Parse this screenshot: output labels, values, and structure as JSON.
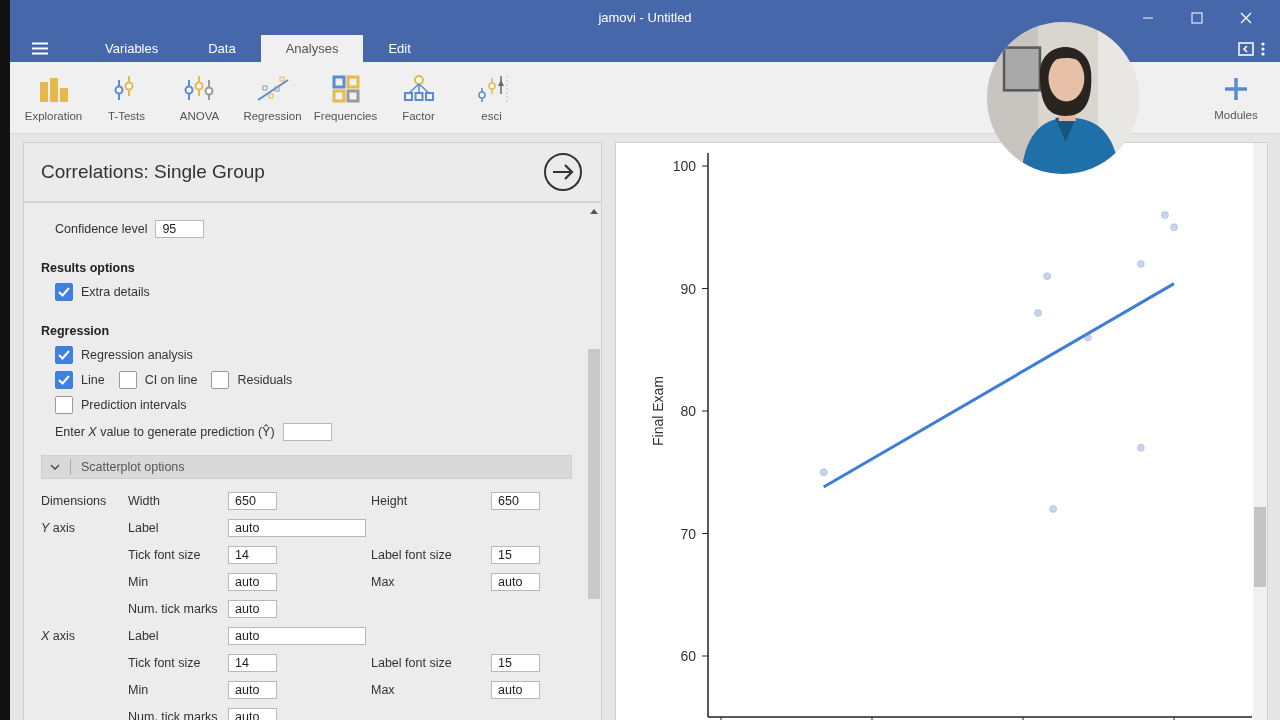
{
  "window": {
    "title": "jamovi - Untitled"
  },
  "menu_tabs": [
    {
      "label": "Variables",
      "selected": false
    },
    {
      "label": "Data",
      "selected": false
    },
    {
      "label": "Analyses",
      "selected": true
    },
    {
      "label": "Edit",
      "selected": false
    }
  ],
  "toolbar": [
    {
      "label": "Exploration",
      "kind": "exploration"
    },
    {
      "label": "T-Tests",
      "kind": "ttests"
    },
    {
      "label": "ANOVA",
      "kind": "anova"
    },
    {
      "label": "Regression",
      "kind": "regression"
    },
    {
      "label": "Frequencies",
      "kind": "frequencies"
    },
    {
      "label": "Factor",
      "kind": "factor"
    },
    {
      "label": "esci",
      "kind": "esci"
    }
  ],
  "modules": {
    "label": "Modules"
  },
  "panel": {
    "title": "Correlations: Single Group",
    "confidence": {
      "label": "Confidence level",
      "value": "95"
    },
    "sections": [
      {
        "heading": "Results options",
        "rows": [
          [
            {
              "label": "Extra details",
              "checked": true
            }
          ]
        ]
      },
      {
        "heading": "Regression",
        "rows": [
          [
            {
              "label": "Regression analysis",
              "checked": true
            }
          ],
          [
            {
              "label": "Line",
              "checked": true
            },
            {
              "label": "CI on line",
              "checked": false
            },
            {
              "label": "Residuals",
              "checked": false
            }
          ],
          [
            {
              "label": "Prediction intervals",
              "checked": false
            }
          ]
        ]
      }
    ],
    "prediction": {
      "label": "Enter *X* value to generate prediction (Ŷ)"
    },
    "scatterplot": {
      "title": "Scatterplot options",
      "expanded": true,
      "rows": [
        {
          "group": "Dimensions",
          "fields": [
            {
              "label": "Width",
              "value": "650"
            },
            {
              "label": "Height",
              "value": "650"
            }
          ]
        },
        {
          "group": "*Y* axis",
          "fields": [
            {
              "label": "Label",
              "value": "auto",
              "kind": "wide"
            }
          ]
        },
        {
          "fields": [
            {
              "label": "Tick font size",
              "value": "14"
            },
            {
              "label": "Label font size",
              "value": "15"
            }
          ]
        },
        {
          "fields": [
            {
              "label": "Min",
              "value": "auto"
            },
            {
              "label": "Max",
              "value": "auto"
            }
          ]
        },
        {
          "fields": [
            {
              "label": "Num. tick marks",
              "value": "auto"
            }
          ]
        },
        {
          "group": "*X* axis",
          "fields": [
            {
              "label": "Label",
              "value": "auto",
              "kind": "wide"
            }
          ]
        },
        {
          "fields": [
            {
              "label": "Tick font size",
              "value": "14"
            },
            {
              "label": "Label font size",
              "value": "15"
            }
          ]
        },
        {
          "fields": [
            {
              "label": "Min",
              "value": "auto"
            },
            {
              "label": "Max",
              "value": "auto"
            }
          ]
        },
        {
          "fields": [
            {
              "label": "Num. tick marks",
              "value": "auto"
            }
          ]
        }
      ]
    }
  },
  "results": {
    "y_axis": {
      "label": "Final Exam",
      "ticks": [
        "100",
        "90",
        "80",
        "70",
        "60"
      ]
    }
  }
}
